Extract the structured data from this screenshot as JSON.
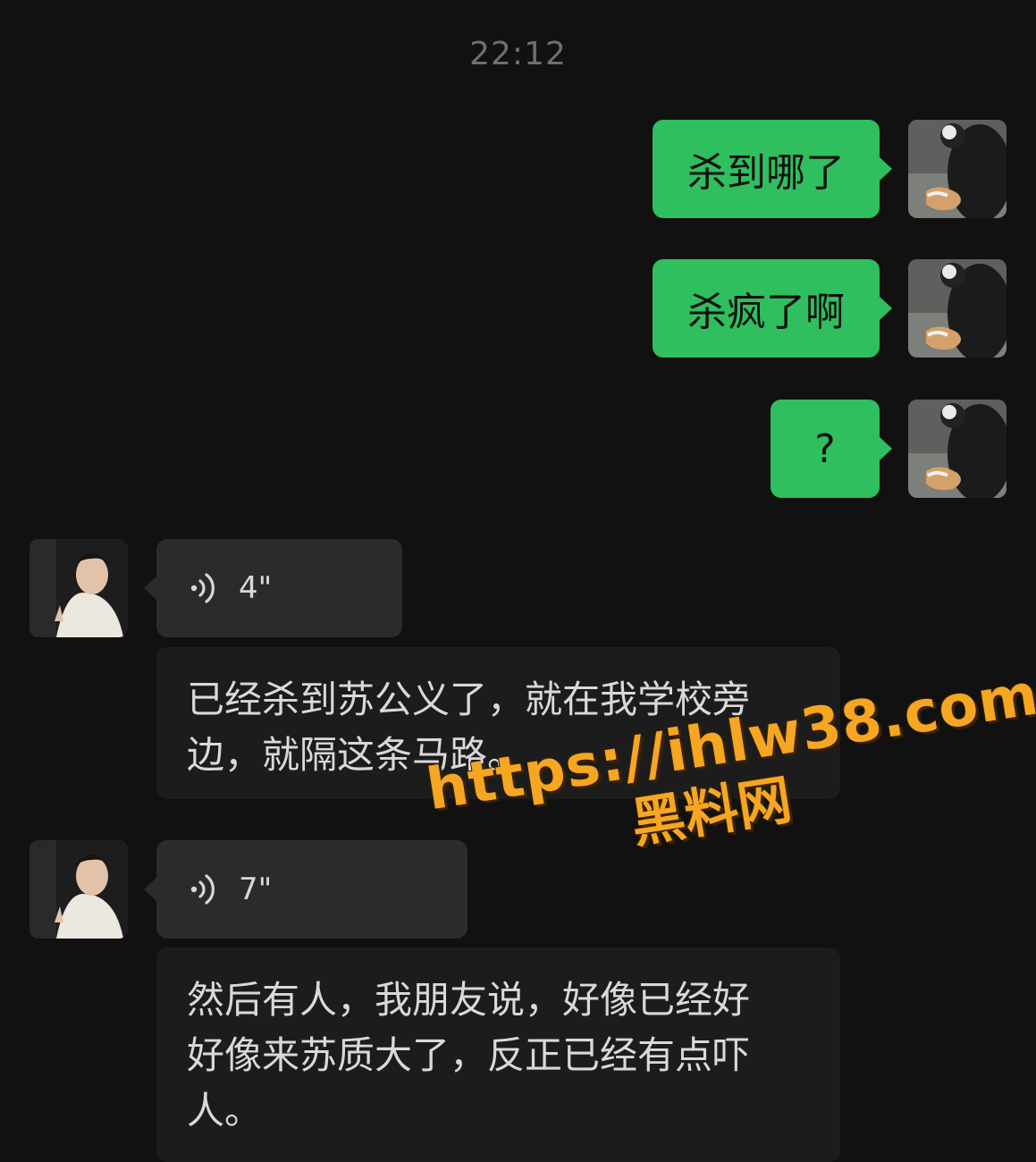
{
  "timestamp": "22:12",
  "outgoing": [
    {
      "text": "杀到哪了"
    },
    {
      "text": "杀疯了啊"
    },
    {
      "text": "?"
    }
  ],
  "incoming": [
    {
      "voice_duration": "4\"",
      "transcript": "已经杀到苏公义了，就在我学校旁\n边，就隔这条马路。"
    },
    {
      "voice_duration": "7\"",
      "transcript": "然后有人，我朋友说，好像已经好\n好像来苏质大了，反正已经有点吓\n人。"
    }
  ],
  "watermark": {
    "url": "https://ihlw38.com",
    "site": "黑料网"
  },
  "colors": {
    "background": "#111111",
    "outgoing_bubble": "#2fbf5e",
    "incoming_bubble": "#2b2b2b",
    "transcript_bg": "#1c1c1c",
    "watermark": "#f5a623"
  }
}
